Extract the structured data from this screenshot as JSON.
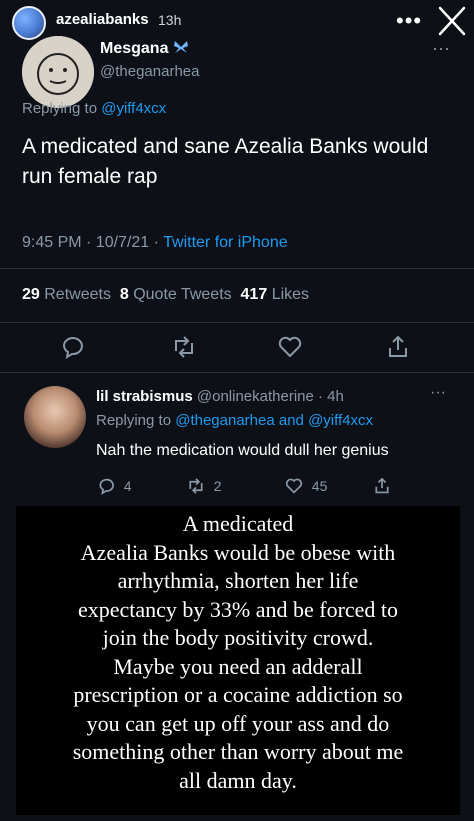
{
  "story": {
    "username": "azealiabanks",
    "time": "13h",
    "more_icon": "more-horizontal-icon",
    "close_icon": "close-icon"
  },
  "tweet": {
    "author_name": "Mesgana",
    "author_emoji": "butterfly-emoji",
    "author_handle": "@theganarhea",
    "replying_prefix": "Replying to ",
    "replying_to": "@yiff4xcx",
    "text": "A medicated and sane Azealia Banks would run female rap",
    "time": "9:45 PM · 10/7/21 · ",
    "source": "Twitter for iPhone",
    "retweets_count": "29",
    "retweets_label": "Retweets",
    "quotes_count": "8",
    "quotes_label": "Quote Tweets",
    "likes_count": "417",
    "likes_label": "Likes"
  },
  "reply": {
    "author_name": "lil strabismus",
    "author_handle": "@onlinekatherine",
    "time": "· 4h",
    "replying_prefix": "Replying to ",
    "replying_to_1": "@theganarhea",
    "replying_and": " and ",
    "replying_to_2": "@yiff4xcx",
    "text": "Nah the medication would dull her genius",
    "reply_count": "4",
    "retweet_count": "2",
    "like_count": "45"
  },
  "caption": {
    "text": "A medicated\nAzealia Banks would be obese with\narrhythmia, shorten her life\nexpectancy by 33% and be forced to\njoin the body positivity crowd.\nMaybe you need an adderall\nprescription or a cocaine addiction so\nyou can get up off your ass and do\nsomething other than worry about me\nall damn day."
  },
  "colors": {
    "background": "#0d1117",
    "accent": "#1d9bf0",
    "muted": "#8b98a5"
  }
}
